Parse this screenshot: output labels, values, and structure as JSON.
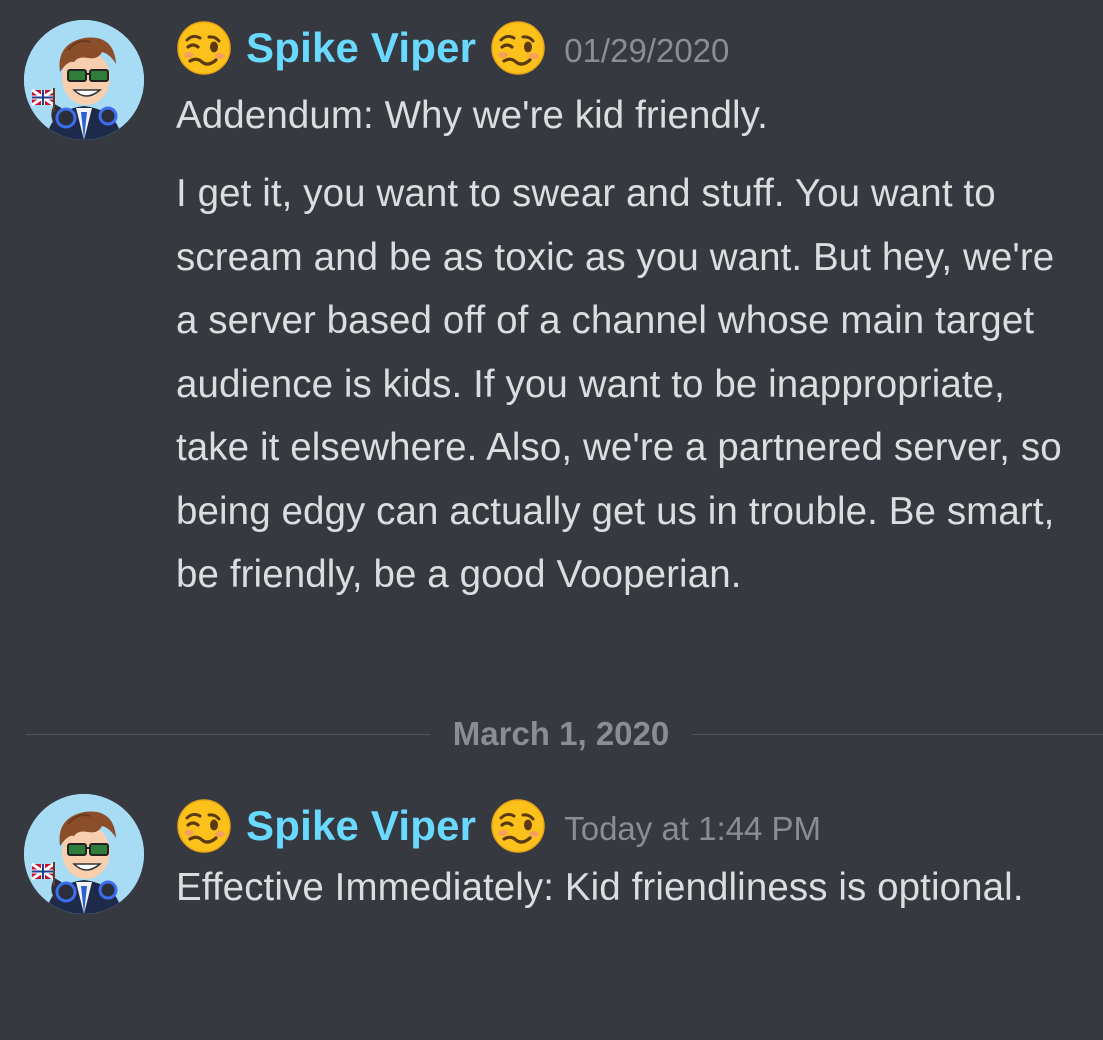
{
  "messages": [
    {
      "username": "Spike Viper",
      "timestamp": "01/29/2020",
      "avatar_icon": "user-avatar",
      "badge_icon": "woozy-face-emoji",
      "paragraphs": [
        "Addendum: Why we're kid friendly.",
        "I get it, you want to swear and stuff. You want to scream and be as toxic as you want. But hey, we're a server based off of a channel whose main target audience is kids. If you want to be inappropriate, take it elsewhere. Also, we're a partnered server, so being edgy can actually get us in trouble. Be smart, be friendly, be a good Vooperian."
      ]
    },
    {
      "username": "Spike Viper",
      "timestamp": "Today at 1:44 PM",
      "avatar_icon": "user-avatar",
      "badge_icon": "woozy-face-emoji",
      "paragraphs": [
        "Effective Immediately: Kid friendliness is optional."
      ]
    }
  ],
  "date_divider": {
    "label": "March 1, 2020"
  },
  "colors": {
    "background": "#36393f",
    "username": "#6ad9ff",
    "message_text": "#dcddde",
    "muted_text": "#8a8e94"
  }
}
